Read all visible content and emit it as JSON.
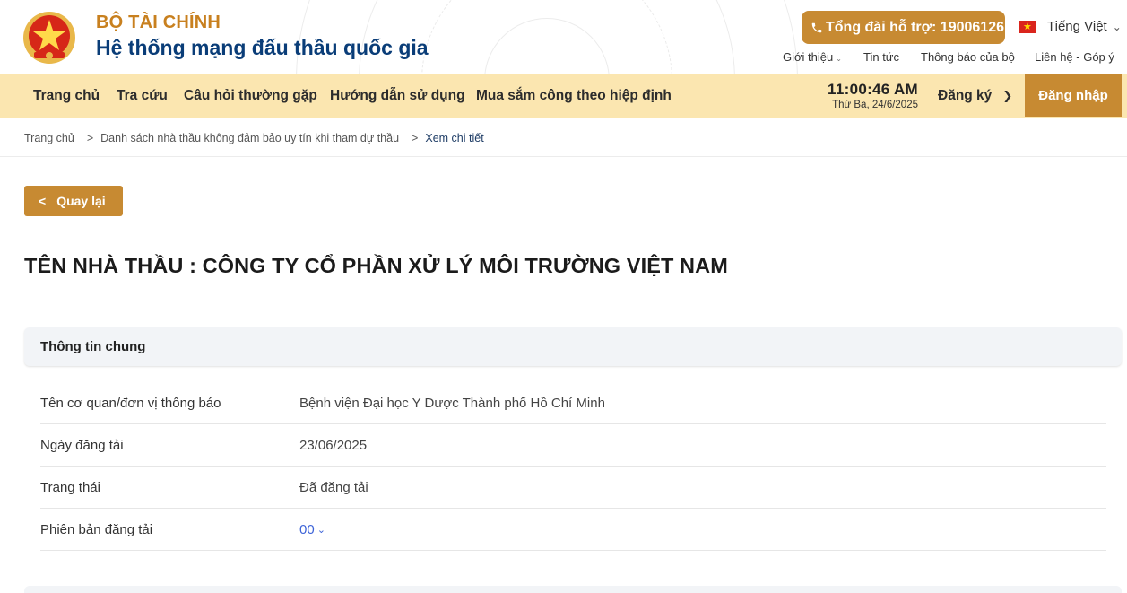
{
  "header": {
    "ministry": "BỘ TÀI CHÍNH",
    "site_name": "Hệ thống mạng đấu thầu quốc gia",
    "hotline": "Tổng đài hỗ trợ: 19006126",
    "language": "Tiếng Việt",
    "top_links": [
      "Giới thiệu",
      "Tin tức",
      "Thông báo của bộ",
      "Liên hệ - Góp ý"
    ]
  },
  "nav": {
    "items": [
      "Trang chủ",
      "Tra cứu",
      "Câu hỏi thường gặp",
      "Hướng dẫn sử dụng",
      "Mua sắm công theo hiệp định"
    ],
    "time": "11:00:46 AM",
    "date": "Thứ Ba, 24/6/2025",
    "register": "Đăng ký",
    "login": "Đăng nhập"
  },
  "breadcrumb": {
    "home": "Trang chủ",
    "list": "Danh sách nhà thầu không đảm bảo uy tín khi tham dự thầu",
    "current": "Xem chi tiết",
    "separator": ">"
  },
  "back_label": "Quay lại",
  "contractor_title": "TÊN NHÀ THẦU : CÔNG TY CỔ PHẦN XỬ LÝ MÔI TRƯỜNG VIỆT NAM",
  "section": {
    "title": "Thông tin chung",
    "rows": [
      {
        "label": "Tên cơ quan/đơn vị thông báo",
        "value": "Bệnh viện Đại học Y Dược Thành phố Hồ Chí Minh"
      },
      {
        "label": "Ngày đăng tải",
        "value": "23/06/2025"
      },
      {
        "label": "Trạng thái",
        "value": "Đã đăng tải"
      },
      {
        "label": "Phiên bản đăng tải",
        "value": "00"
      }
    ]
  },
  "colors": {
    "accent": "#c78a32",
    "nav_bg": "#fbe6b0",
    "brand_blue": "#0a3d78",
    "link_blue": "#3d63d8"
  }
}
